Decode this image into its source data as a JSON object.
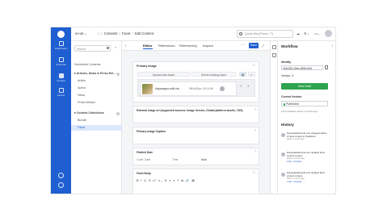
{
  "nav": {
    "items": [
      {
        "label": "Dashboard"
      },
      {
        "label": "Schemas"
      },
      {
        "label": "Content"
      },
      {
        "label": "Assets"
      }
    ]
  },
  "topbar": {
    "locale": "en-uk ⌄",
    "breadcrumb": [
      "Contents",
      "Facet",
      "Edit Content"
    ],
    "quick_find_placeholder": "Quick find (Press \"/\")"
  },
  "tree": {
    "search_placeholder": "Search",
    "rows": [
      {
        "label": "Scheduled Contents",
        "kind": "sub"
      },
      {
        "label": "Articles, News & Press Rel...",
        "kind": "sec"
      },
      {
        "label": "Article",
        "kind": "sub"
      },
      {
        "label": "Author",
        "kind": "sub"
      },
      {
        "label": "News",
        "kind": "sub"
      },
      {
        "label": "Press release",
        "kind": "sub"
      },
      {
        "label": "Content Collections",
        "kind": "sec"
      },
      {
        "label": "Bundle",
        "kind": "sub"
      },
      {
        "label": "Facet",
        "kind": "sub",
        "selected": true
      }
    ]
  },
  "editor": {
    "tabs": [
      "Editor",
      "References",
      "Referencing",
      "Inspect"
    ],
    "save_label": "Save",
    "primary_image": {
      "title": "Primary Image",
      "upload_label": "Upload new Asset",
      "select_label": "Select existing Asset",
      "asset_name": "Asparagus with he...",
      "asset_meta": "960x634px, 119.6 kB"
    },
    "external_image": {
      "title": "External image url (supported sources: Image Service, Global platform assets, YDS)"
    },
    "caption": {
      "title": "Primary Image Caption"
    },
    "publish_date": {
      "title": "Publish Date",
      "local_label": "Local",
      "date_placeholder": "Date",
      "time_placeholder": "Time",
      "now_label": "Now"
    },
    "body": {
      "title": "Facet Body",
      "toolbar": "B I U S x² x₂ H ≡ ≡ ❝ ⧉ 🔗 ▤"
    }
  },
  "workflow": {
    "title": "Workflow",
    "identity_label": "Identity",
    "identity_value": "f3a0316-20ee-4606-b0c0",
    "version_label": "Version: 3",
    "new_draft_label": "New Draft",
    "current_version_label": "Current Version",
    "status": "Published",
    "last_updated": "Last Updated: about 1 month ago",
    "history_title": "History",
    "history": [
      {
        "text": "liweepdarleshoods.com changed status of facet content to Published.",
        "meta": "about 1 month ago",
        "link": ""
      },
      {
        "text": "liweepdarleshoods.com updated facet content content.",
        "meta": "about 1 month ago",
        "link": "Load · Compare"
      },
      {
        "text": "liweepdarleshoods.com updated facet content content.",
        "meta": "about 1 month ago",
        "link": "Load · Compare"
      }
    ]
  }
}
